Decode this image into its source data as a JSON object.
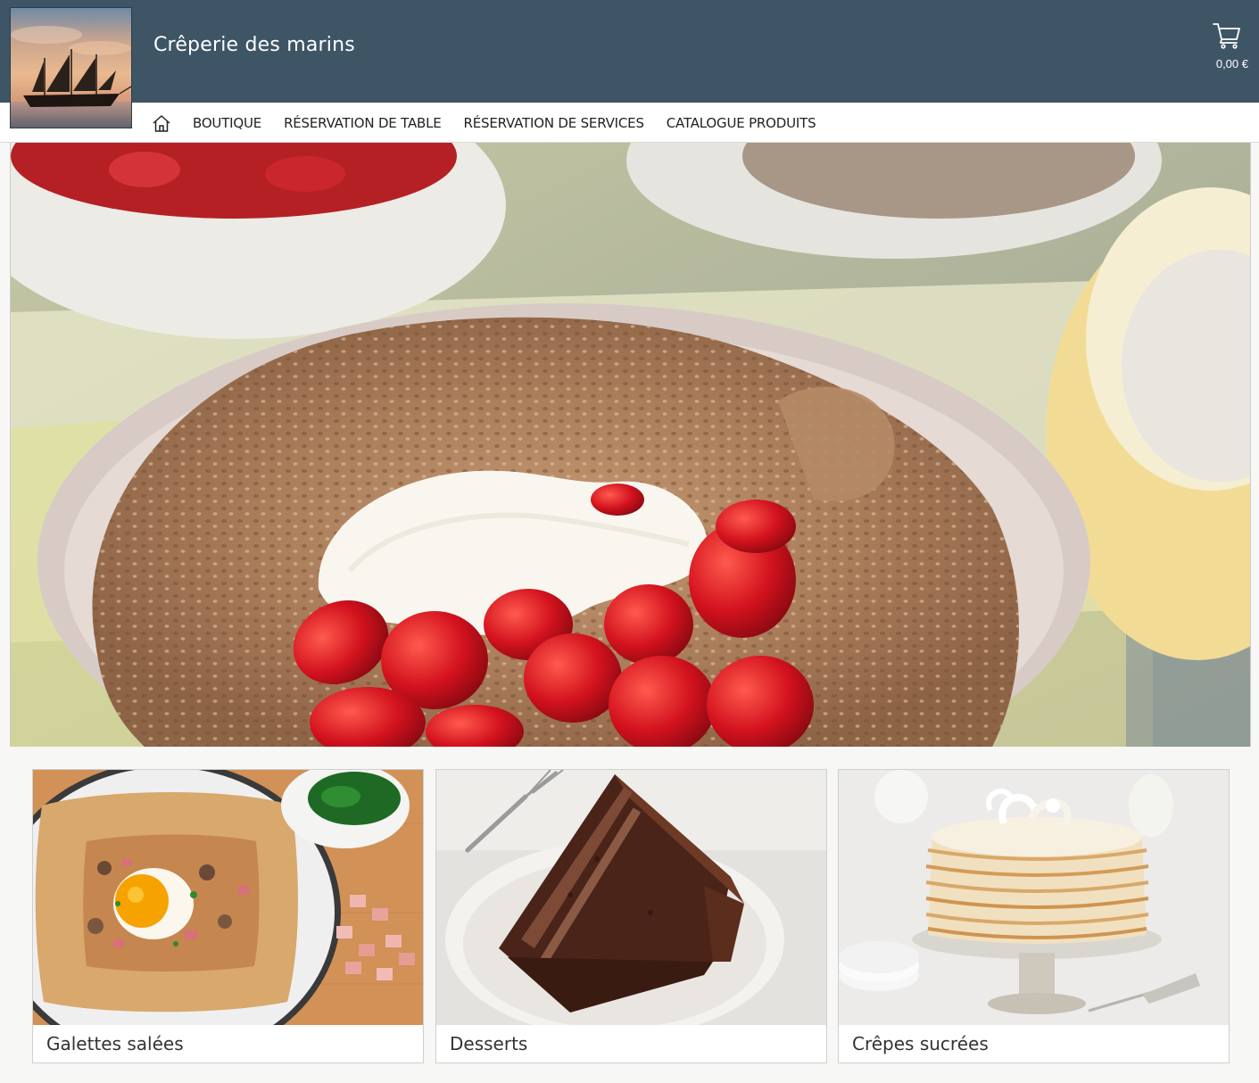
{
  "header": {
    "site_title": "Crêperie des marins",
    "cart_total": "0,00 €",
    "cart_icon": "shopping-cart-icon",
    "background_color": "#3e5565"
  },
  "nav": {
    "home_icon": "home-icon",
    "items": [
      {
        "label": "BOUTIQUE"
      },
      {
        "label": "RÉSERVATION DE TABLE"
      },
      {
        "label": "RÉSERVATION DE SERVICES"
      },
      {
        "label": "CATALOGUE PRODUITS"
      }
    ]
  },
  "categories": [
    {
      "label": "Galettes salées"
    },
    {
      "label": "Desserts"
    },
    {
      "label": "Crêpes sucrées"
    }
  ]
}
